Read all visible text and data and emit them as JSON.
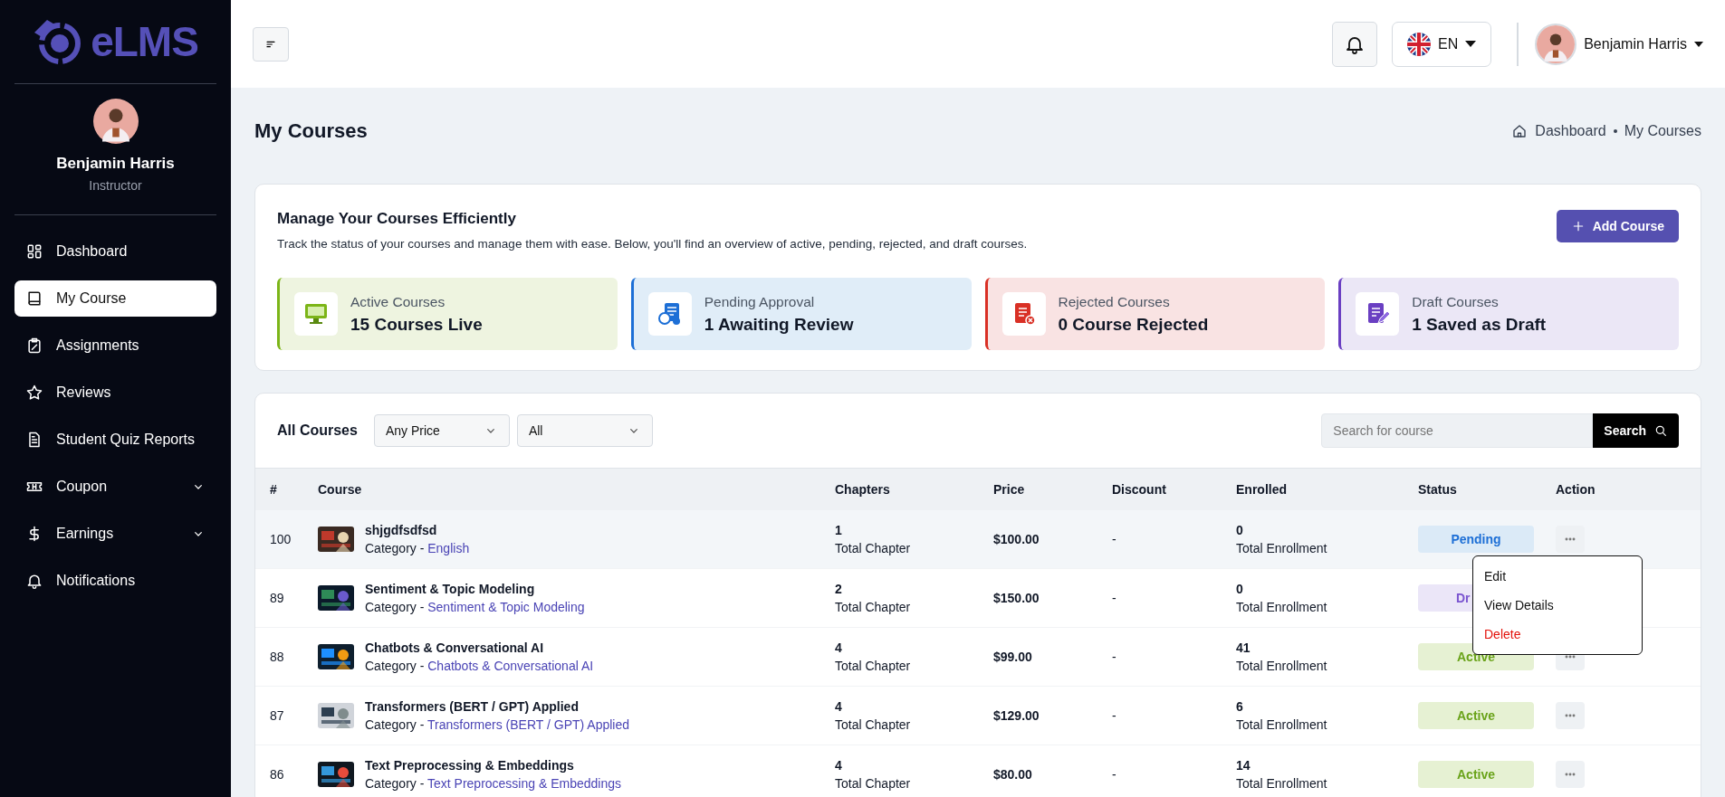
{
  "sidebar": {
    "logo": "eLMS",
    "user": {
      "name": "Benjamin Harris",
      "role": "Instructor"
    },
    "items": [
      {
        "label": "Dashboard",
        "selected": false,
        "has_submenu": false
      },
      {
        "label": "My Course",
        "selected": true,
        "has_submenu": false
      },
      {
        "label": "Assignments",
        "selected": false,
        "has_submenu": false
      },
      {
        "label": "Reviews",
        "selected": false,
        "has_submenu": false
      },
      {
        "label": "Student Quiz Reports",
        "selected": false,
        "has_submenu": false
      },
      {
        "label": "Coupon",
        "selected": false,
        "has_submenu": true
      },
      {
        "label": "Earnings",
        "selected": false,
        "has_submenu": true
      },
      {
        "label": "Notifications",
        "selected": false,
        "has_submenu": false
      }
    ]
  },
  "header": {
    "language": "EN",
    "user_name": "Benjamin Harris"
  },
  "page": {
    "title": "My Courses",
    "breadcrumb": [
      "Dashboard",
      "My Courses"
    ]
  },
  "overview": {
    "title": "Manage Your Courses Efficiently",
    "description": "Track the status of your courses and manage them with ease. Below, you'll find an overview of active, pending, rejected, and draft courses.",
    "add_button": "Add Course",
    "stats": [
      {
        "kind": "active",
        "label": "Active Courses",
        "value": "15 Courses Live"
      },
      {
        "kind": "pending",
        "label": "Pending Approval",
        "value": "1 Awaiting Review"
      },
      {
        "kind": "rejected",
        "label": "Rejected Courses",
        "value": "0 Course Rejected"
      },
      {
        "kind": "draft",
        "label": "Draft Courses",
        "value": "1 Saved as Draft"
      }
    ]
  },
  "courses": {
    "title": "All Courses",
    "filters": [
      "Any Price",
      "All"
    ],
    "search": {
      "placeholder": "Search for course",
      "button": "Search"
    },
    "columns": [
      "#",
      "Course",
      "Chapters",
      "Price",
      "Discount",
      "Enrolled",
      "Status",
      "Action"
    ],
    "rows": [
      {
        "id": "100",
        "name": "shjgdfsdfsd",
        "category_label": "Category -",
        "category": "English",
        "chapters": "1",
        "chapters_label": "Total Chapter",
        "price": "$100.00",
        "discount": "-",
        "enrolled": "0",
        "enrolled_label": "Total Enrollment",
        "status": "Pending",
        "kind": "pending",
        "selected": true
      },
      {
        "id": "89",
        "name": "Sentiment & Topic Modeling",
        "category_label": "Category -",
        "category": "Sentiment & Topic Modeling",
        "chapters": "2",
        "chapters_label": "Total Chapter",
        "price": "$150.00",
        "discount": "-",
        "enrolled": "0",
        "enrolled_label": "Total Enrollment",
        "status": "Dr",
        "kind": "draft",
        "selected": false
      },
      {
        "id": "88",
        "name": "Chatbots & Conversational AI",
        "category_label": "Category -",
        "category": "Chatbots & Conversational AI",
        "chapters": "4",
        "chapters_label": "Total Chapter",
        "price": "$99.00",
        "discount": "-",
        "enrolled": "41",
        "enrolled_label": "Total Enrollment",
        "status": "Active",
        "kind": "active",
        "selected": false
      },
      {
        "id": "87",
        "name": "Transformers (BERT / GPT) Applied",
        "category_label": "Category -",
        "category": "Transformers (BERT / GPT) Applied",
        "chapters": "4",
        "chapters_label": "Total Chapter",
        "price": "$129.00",
        "discount": "-",
        "enrolled": "6",
        "enrolled_label": "Total Enrollment",
        "status": "Active",
        "kind": "active",
        "selected": false
      },
      {
        "id": "86",
        "name": "Text Preprocessing & Embeddings",
        "category_label": "Category -",
        "category": "Text Preprocessing & Embeddings",
        "chapters": "4",
        "chapters_label": "Total Chapter",
        "price": "$80.00",
        "discount": "-",
        "enrolled": "14",
        "enrolled_label": "Total Enrollment",
        "status": "Active",
        "kind": "active",
        "selected": false
      }
    ],
    "action_menu": [
      {
        "label": "Edit",
        "kind": "normal"
      },
      {
        "label": "View Details",
        "kind": "normal"
      },
      {
        "label": "Delete",
        "kind": "danger"
      }
    ]
  }
}
